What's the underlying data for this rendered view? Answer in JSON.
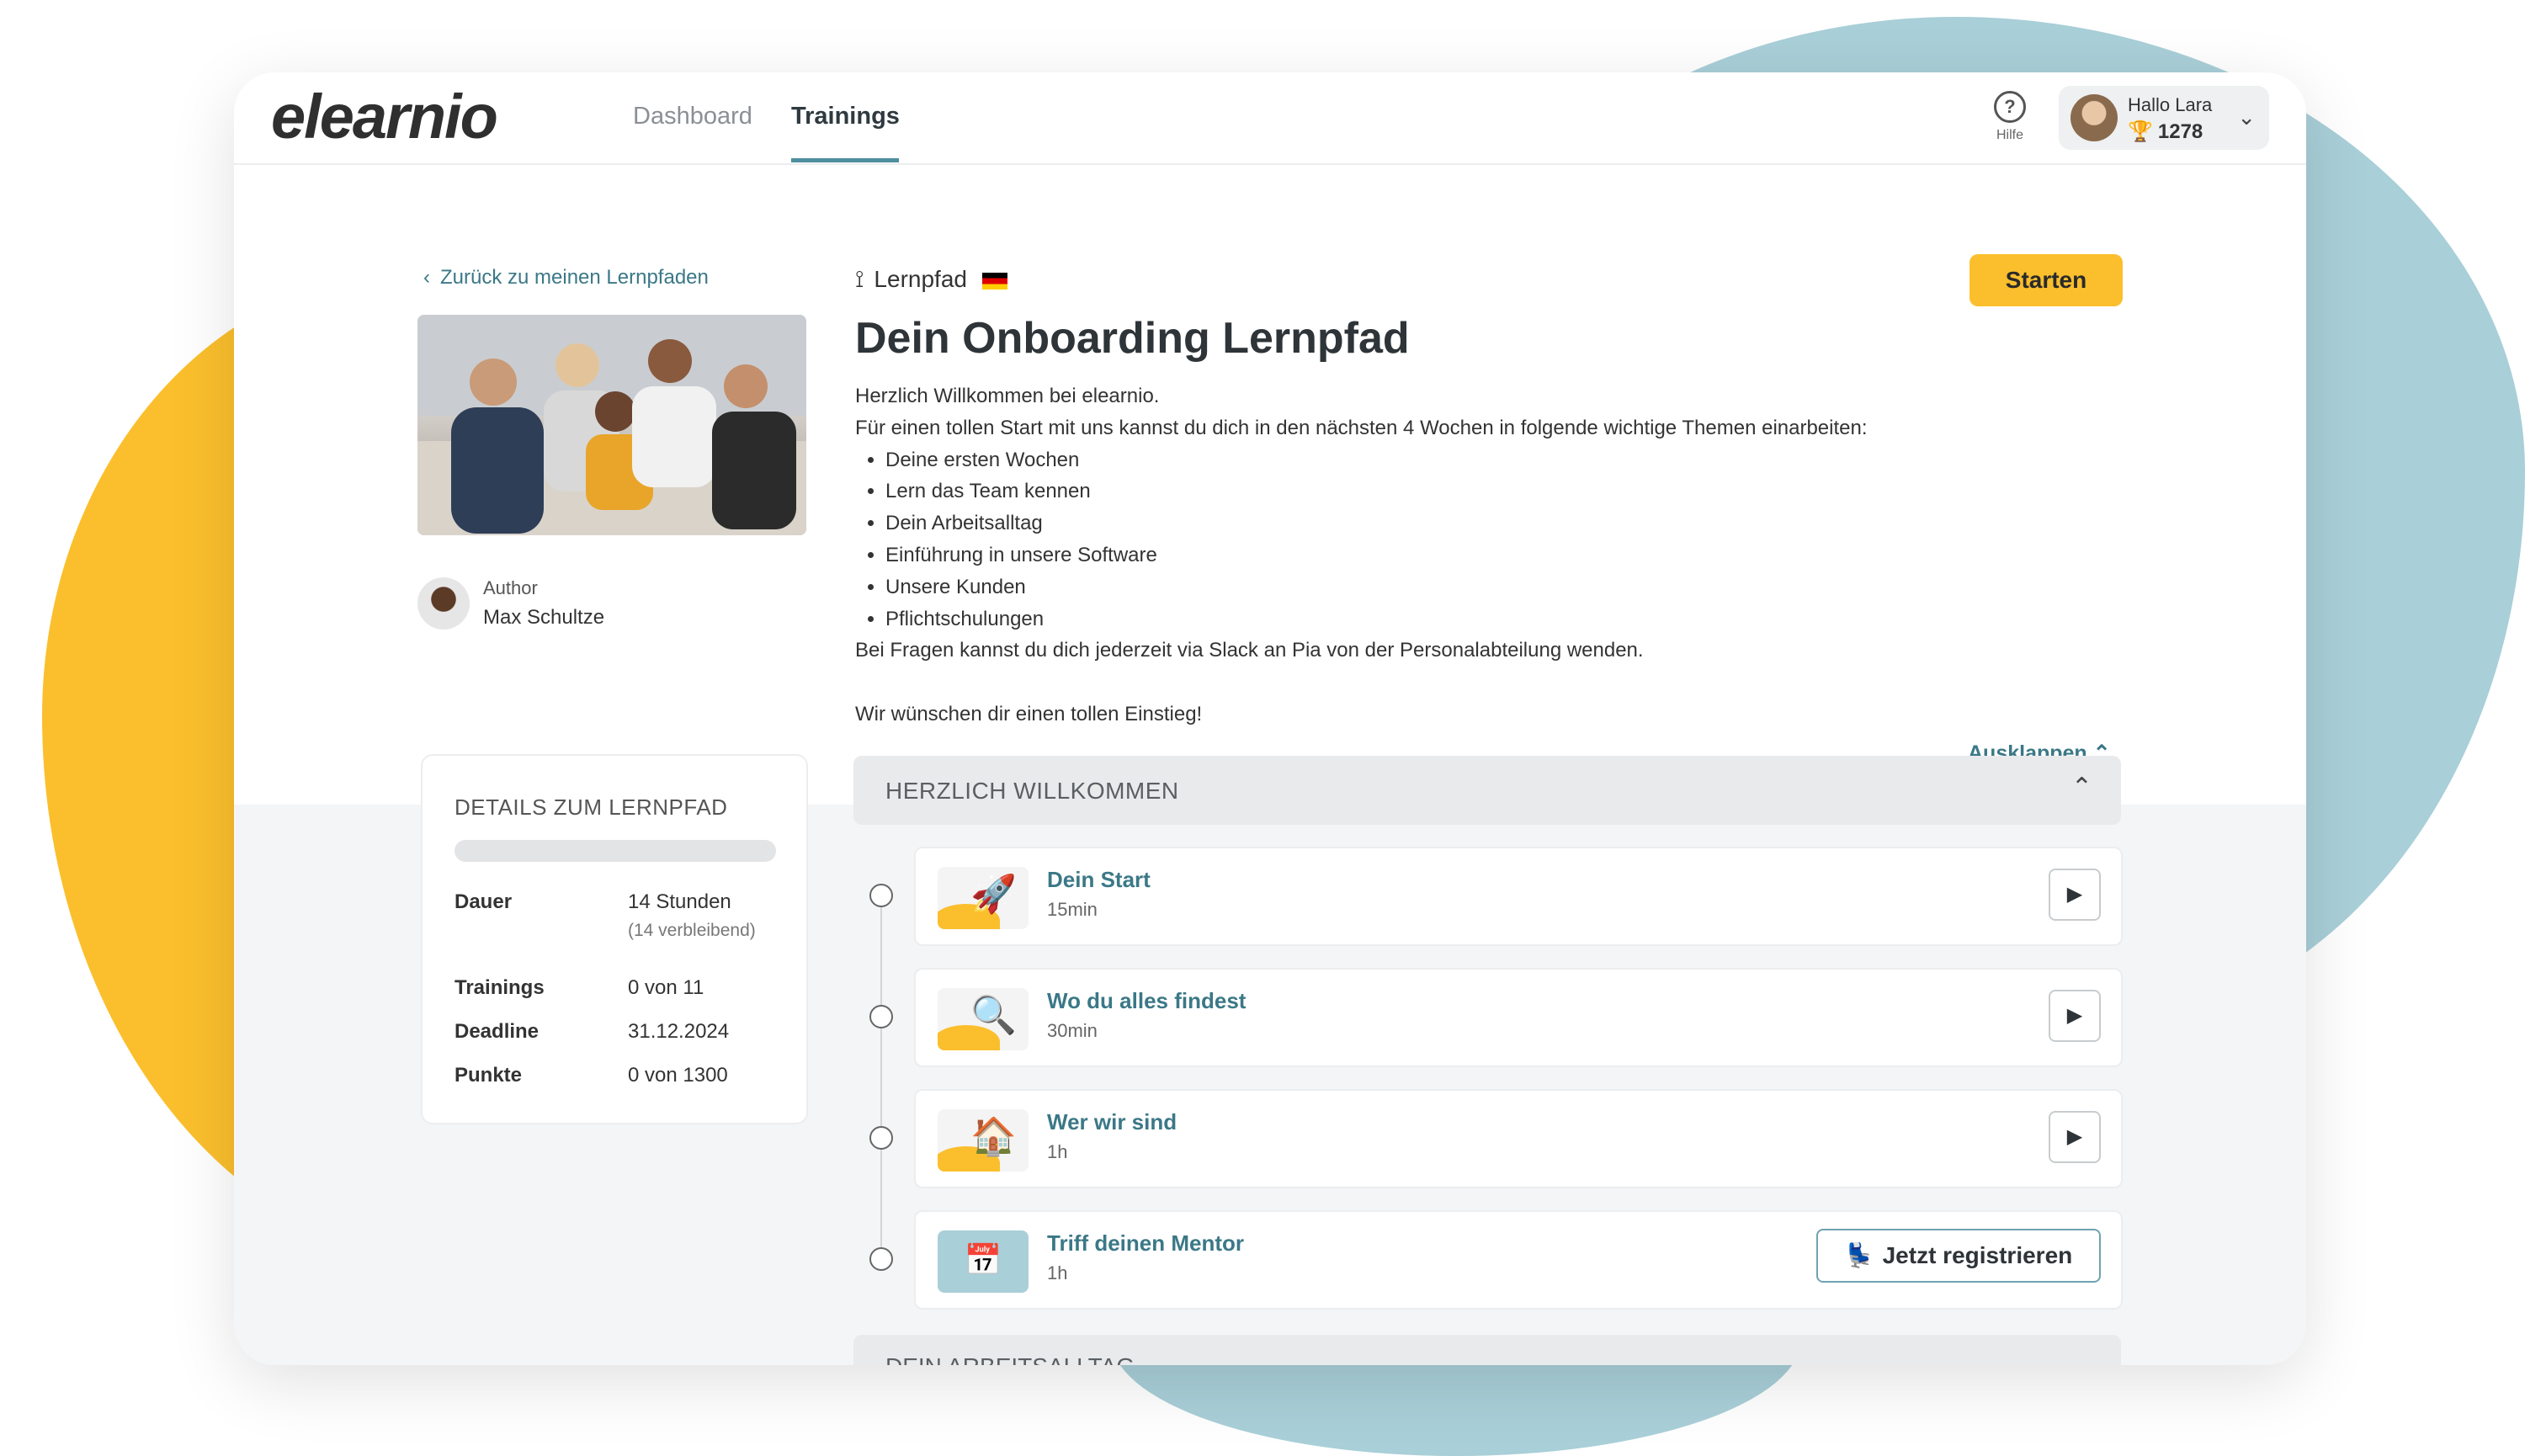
{
  "app": {
    "logo": "elearnio"
  },
  "nav": {
    "items": [
      {
        "label": "Dashboard"
      },
      {
        "label": "Trainings"
      }
    ]
  },
  "help": {
    "label": "Hilfe"
  },
  "user": {
    "greeting": "Hallo Lara",
    "points": "1278"
  },
  "lernpfad": {
    "back_link": "Zurück zu meinen Lernpfaden",
    "tag": "Lernpfad",
    "start_label": "Starten",
    "title": "Dein Onboarding Lernpfad",
    "intro": "Herzlich Willkommen bei elearnio.",
    "intro2": "Für einen tollen Start mit uns kannst du dich  in den nächsten 4 Wochen in folgende wichtige Themen einarbeiten:",
    "topics": [
      "Deine ersten Wochen",
      "Lern das Team kennen",
      "Dein Arbeitsalltag",
      "Einführung in unsere Software",
      "Unsere Kunden",
      "Pflichtschulungen"
    ],
    "outro": "Bei Fragen kannst du dich jederzeit via Slack an Pia von der Personalabteilung wenden.",
    "closing": "Wir wünschen dir einen tollen Einstieg!",
    "expand_label": "Ausklappen",
    "author_label": "Author",
    "author_name": "Max Schultze"
  },
  "details": {
    "title": "DETAILS ZUM LERNPFAD",
    "progress": 0,
    "rows": [
      {
        "label": "Dauer",
        "value": "14 Stunden"
      },
      {
        "label": "Trainings",
        "value": "0 von 11"
      },
      {
        "label": "Deadline",
        "value": "31.12.2024"
      },
      {
        "label": "Punkte",
        "value": "0 von 1300"
      }
    ],
    "remaining": "(14 verbleibend)"
  },
  "sections": [
    {
      "title": "HERZLICH WILLKOMMEN",
      "items": [
        {
          "title": "Dein Start",
          "duration": "15min",
          "icon": "rocket-icon",
          "action": "play"
        },
        {
          "title": "Wo du alles findest",
          "duration": "30min",
          "icon": "magnifier-icon",
          "action": "play"
        },
        {
          "title": "Wer wir sind",
          "duration": "1h",
          "icon": "house-icon",
          "action": "play"
        },
        {
          "title": "Triff deinen Mentor",
          "duration": "1h",
          "icon": "calendar-icon",
          "action": "register",
          "action_label": "Jetzt registrieren"
        }
      ]
    },
    {
      "title": "DEIN ARBEITSALLTAG"
    }
  ],
  "colors": {
    "accent": "#FBBF2D",
    "teal": "#4E8FA0",
    "link": "#3B7887"
  }
}
